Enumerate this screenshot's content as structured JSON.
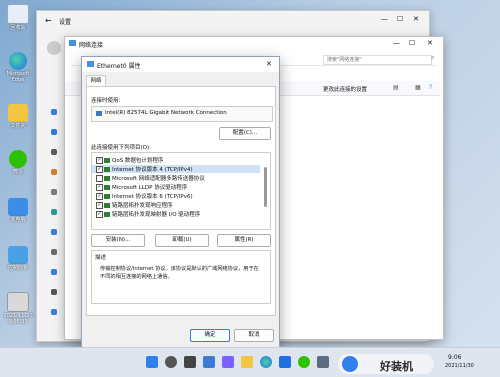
{
  "desktop": {
    "icons": [
      {
        "label": "回收站"
      },
      {
        "label": "Microsoft Edge"
      },
      {
        "label": "文件夹"
      },
      {
        "label": "微信"
      },
      {
        "label": "此电脑"
      },
      {
        "label": "控制面板"
      },
      {
        "label": "2021-11-30 9:06:39"
      }
    ]
  },
  "settings": {
    "title": "设置",
    "back_icon": "arrow-left-icon",
    "controls": {
      "minimize": "—",
      "maximize": "☐",
      "close": "✕"
    }
  },
  "network_window": {
    "title": "网络连接",
    "search_placeholder": "搜索\"网络连接\"",
    "command": "更改此连接的设置",
    "controls": {
      "minimize": "—",
      "maximize": "☐",
      "close": "✕"
    }
  },
  "dialog": {
    "title": "Ethernet0 属性",
    "close": "✕",
    "tab": "网络",
    "connect_using_label": "连接时使用:",
    "adapter": "Intel(R) 82574L Gigabit Network Connection",
    "configure_button": "配置(C)...",
    "items_label": "此连接使用下列项目(O):",
    "items": [
      {
        "label": "QoS 数据包计划程序",
        "checked": true,
        "selected": false
      },
      {
        "label": "Internet 协议版本 4 (TCP/IPv4)",
        "checked": true,
        "selected": true
      },
      {
        "label": "Microsoft 网络适配器多路传送器协议",
        "checked": false,
        "selected": false
      },
      {
        "label": "Microsoft LLDP 协议驱动程序",
        "checked": true,
        "selected": false
      },
      {
        "label": "Internet 协议版本 6 (TCP/IPv6)",
        "checked": true,
        "selected": false
      },
      {
        "label": "链路层拓扑发现响应程序",
        "checked": true,
        "selected": false
      },
      {
        "label": "链路层拓扑发现映射器 I/O 驱动程序",
        "checked": true,
        "selected": false
      }
    ],
    "install_button": "安装(N)...",
    "uninstall_button": "卸载(U)",
    "properties_button": "属性(R)",
    "description_label": "描述",
    "description_text": "传输控制协议/Internet 协议。该协议是默认的广域网络协议，用于在不同的相互连接的网络上通信。",
    "ok_button": "确定",
    "cancel_button": "取消"
  },
  "taskbar": {
    "time": "9:06",
    "date": "2021/11/30",
    "watermark": "好装机"
  }
}
